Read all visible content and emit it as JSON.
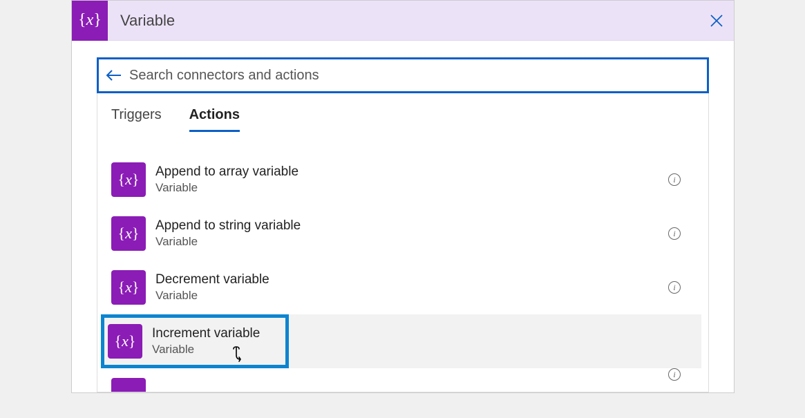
{
  "header": {
    "title": "Variable",
    "icon_label": "x"
  },
  "search": {
    "placeholder": "Search connectors and actions"
  },
  "tabs": [
    {
      "label": "Triggers",
      "active": false
    },
    {
      "label": "Actions",
      "active": true
    }
  ],
  "actions": [
    {
      "title": "Append to array variable",
      "subtitle": "Variable"
    },
    {
      "title": "Append to string variable",
      "subtitle": "Variable"
    },
    {
      "title": "Decrement variable",
      "subtitle": "Variable"
    },
    {
      "title": "Increment variable",
      "subtitle": "Variable"
    }
  ]
}
